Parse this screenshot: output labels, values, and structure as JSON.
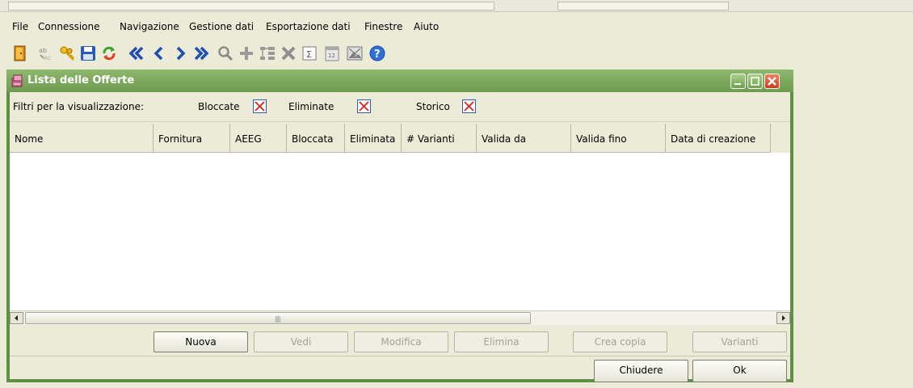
{
  "menu": [
    "File",
    "Connessione",
    "Navigazione",
    "Gestione dati",
    "Esportazione dati",
    "Finestre",
    "Aiuto"
  ],
  "toolbar_icons": [
    "exit-door-icon",
    "find-replace-icon",
    "keys-icon",
    "save-icon",
    "refresh-icon",
    "first-record-icon",
    "previous-record-icon",
    "next-record-icon",
    "last-record-icon",
    "search-icon",
    "add-icon",
    "structure-icon",
    "delete-icon",
    "sum-icon",
    "calendar-icon",
    "image-icon",
    "help-icon"
  ],
  "window": {
    "title": "Lista delle Offerte"
  },
  "filters": {
    "label": "Filtri per la visualizzazione:",
    "items": [
      {
        "label": "Bloccate",
        "checked": true
      },
      {
        "label": "Eliminate",
        "checked": true
      },
      {
        "label": "Storico",
        "checked": true
      }
    ]
  },
  "table": {
    "columns": [
      "Nome",
      "Fornitura",
      "AEEG",
      "Bloccata",
      "Eliminata",
      "# Varianti",
      "Valida da",
      "Valida fino",
      "Data di creazione"
    ],
    "rows": []
  },
  "actions": {
    "nuova": "Nuova",
    "vedi": "Vedi",
    "modifica": "Modifica",
    "elimina": "Elimina",
    "crea_copia": "Crea copia",
    "varianti": "Varianti"
  },
  "footer": {
    "chiudere": "Chiudere",
    "ok": "Ok"
  },
  "colors": {
    "frame": "#5e8f42",
    "title_bar": "#7fac60",
    "checkbox_cross": "#e02020"
  }
}
